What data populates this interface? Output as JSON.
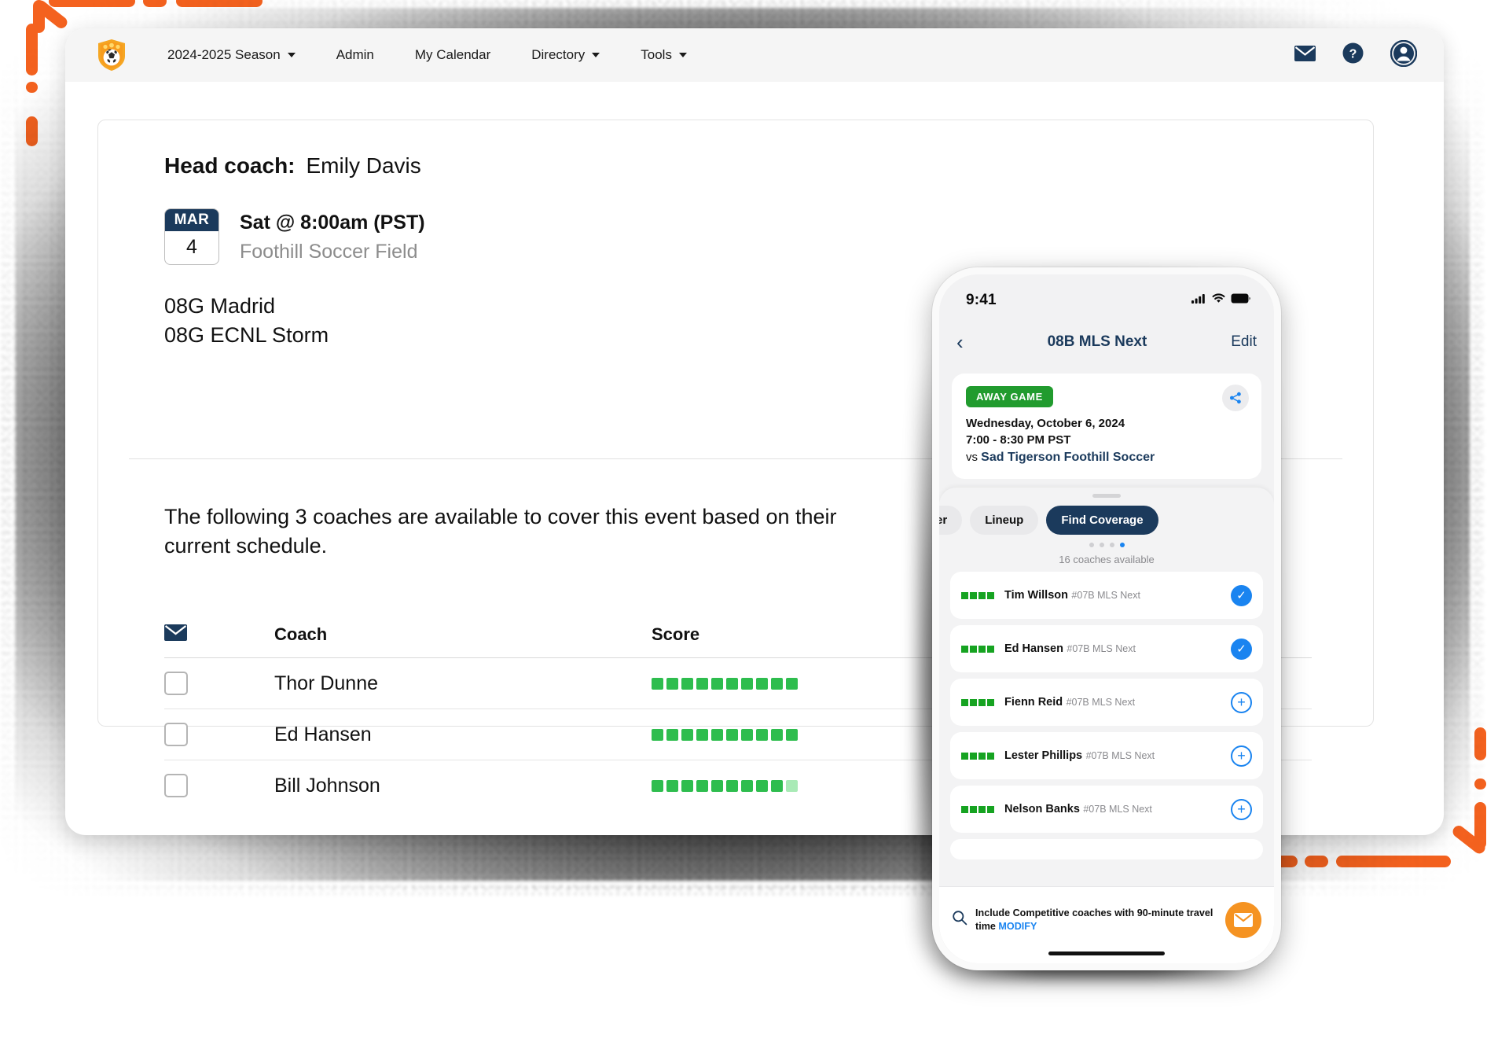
{
  "browser": {
    "topbar": {
      "logo_icon": "soccer-shield-logo",
      "nav": [
        {
          "label": "2024-2025 Season",
          "caret": true
        },
        {
          "label": "Admin",
          "caret": false
        },
        {
          "label": "My Calendar",
          "caret": false
        },
        {
          "label": "Directory",
          "caret": true
        },
        {
          "label": "Tools",
          "caret": true
        }
      ],
      "actions": [
        {
          "icon": "mail-icon",
          "name": "messages-button"
        },
        {
          "icon": "help-icon",
          "name": "help-button"
        },
        {
          "icon": "user-avatar-icon",
          "name": "account-button"
        }
      ]
    },
    "panel": {
      "head_coach_label": "Head coach:",
      "head_coach_name": "Emily Davis",
      "event": {
        "month": "MAR",
        "day": "4",
        "when": "Sat @ 8:00am (PST)",
        "where": "Foothill Soccer Field"
      },
      "teams": [
        "08G Madrid",
        "08G ECNL Storm"
      ],
      "blurb": "The following 3 coaches are available to cover this event based on their current schedule.",
      "table": {
        "headers": {
          "select": "mail-icon",
          "coach": "Coach",
          "score": "Score"
        },
        "rows": [
          {
            "checked": false,
            "coach": "Thor Dunne",
            "score_filled": 10,
            "score_total": 10
          },
          {
            "checked": false,
            "coach": "Ed Hansen",
            "score_filled": 10,
            "score_total": 10
          },
          {
            "checked": false,
            "coach": "Bill Johnson",
            "score_filled": 9,
            "score_total": 10
          }
        ]
      }
    }
  },
  "phone": {
    "status": {
      "time": "9:41",
      "signal_icon": "cellular-signal-icon",
      "wifi_icon": "wifi-icon",
      "battery_icon": "battery-icon"
    },
    "nav": {
      "back_icon": "chevron-left-icon",
      "title": "08B MLS Next",
      "edit": "Edit"
    },
    "game_card": {
      "badge": "AWAY GAME",
      "share_icon": "share-icon",
      "date": "Wednesday, October 6, 2024",
      "time": "7:00 - 8:30 PM PST",
      "vs_prefix": "vs",
      "opponent": "Sad Tigerson Foothill Soccer"
    },
    "tabs": [
      {
        "label": "ter",
        "active": false
      },
      {
        "label": "Lineup",
        "active": false
      },
      {
        "label": "Find Coverage",
        "active": true
      }
    ],
    "pager": {
      "count": 4,
      "active_index": 3
    },
    "available_label": "16 coaches available",
    "coaches": [
      {
        "name": "Tim Willson",
        "team": "#07B MLS Next",
        "bars": 4,
        "action": "check"
      },
      {
        "name": "Ed Hansen",
        "team": "#07B MLS Next",
        "bars": 4,
        "action": "check"
      },
      {
        "name": "Fienn Reid",
        "team": "#07B MLS Next",
        "bars": 4,
        "action": "plus"
      },
      {
        "name": "Lester Phillips",
        "team": "#07B MLS Next",
        "bars": 4,
        "action": "plus"
      },
      {
        "name": "Nelson Banks",
        "team": "#07B MLS Next",
        "bars": 4,
        "action": "plus"
      }
    ],
    "footer": {
      "search_icon": "search-icon",
      "text": "Include Competitive coaches with 90-minute travel time ",
      "link": "MODIFY",
      "fab_icon": "mail-icon"
    }
  },
  "colors": {
    "brand_navy": "#1b3a5c",
    "accent_orange": "#f4621f",
    "score_green": "#2ebd4e",
    "score_green_light": "#a9eab6",
    "ios_blue": "#1a84f0",
    "badge_green": "#219b2e",
    "fab_orange": "#f59322"
  }
}
